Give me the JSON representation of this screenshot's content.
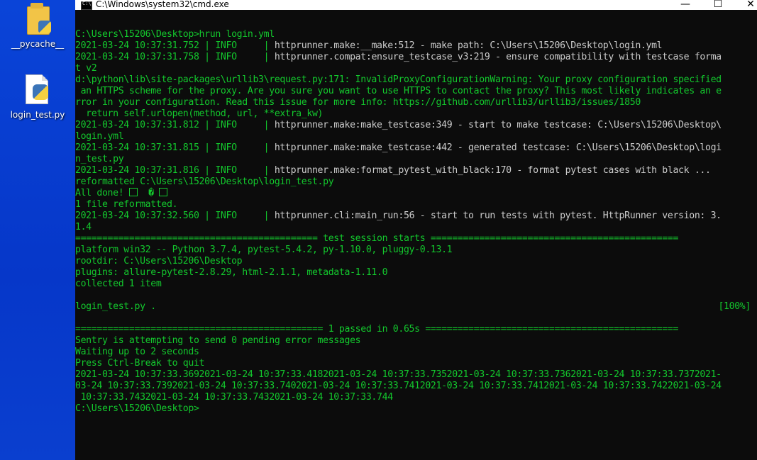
{
  "desktop": {
    "icons": [
      {
        "label": "__pycache__",
        "kind": "folder"
      },
      {
        "label": "login_test.py",
        "kind": "python-file"
      }
    ]
  },
  "window": {
    "title": "C:\\Windows\\system32\\cmd.exe",
    "controls": {
      "minimize": "—",
      "maximize": "☐",
      "close": "✕"
    }
  },
  "console": {
    "lines": [
      "C:\\Users\\15206\\Desktop>hrun login.yml",
      "2021-03-24 10:37:31.752 | INFO     | httprunner.make:__make:512 - make path: C:\\Users\\15206\\Desktop\\login.yml",
      "2021-03-24 10:37:31.758 | INFO     | httprunner.compat:ensure_testcase_v3:219 - ensure compatibility with testcase forma",
      "t v2",
      "d:\\python\\lib\\site-packages\\urllib3\\request.py:171: InvalidProxyConfigurationWarning: Your proxy configuration specified",
      " an HTTPS scheme for the proxy. Are you sure you want to use HTTPS to contact the proxy? This most likely indicates an e",
      "rror in your configuration. Read this issue for more info: https://github.com/urllib3/urllib3/issues/1850",
      "  return self.urlopen(method, url, **extra_kw)",
      "2021-03-24 10:37:31.812 | INFO     | httprunner.make:make_testcase:349 - start to make testcase: C:\\Users\\15206\\Desktop\\",
      "login.yml",
      "2021-03-24 10:37:31.815 | INFO     | httprunner.make:make_testcase:442 - generated testcase: C:\\Users\\15206\\Desktop\\logi",
      "n_test.py",
      "2021-03-24 10:37:31.816 | INFO     | httprunner.make:format_pytest_with_black:170 - format pytest cases with black ...",
      "reformatted C:\\Users\\15206\\Desktop\\login_test.py",
      "All done! ",
      "1 file reformatted.",
      "2021-03-24 10:37:32.560 | INFO     | httprunner.cli:main_run:56 - start to run tests with pytest. HttpRunner version: 3.",
      "1.4",
      "============================================= test session starts ==============================================",
      "platform win32 -- Python 3.7.4, pytest-5.4.2, py-1.10.0, pluggy-0.13.1",
      "rootdir: C:\\Users\\15206\\Desktop",
      "plugins: allure-pytest-2.8.29, html-2.1.1, metadata-1.11.0",
      "collected 1 item",
      "",
      "login_test.py .",
      "",
      "============================================== 1 passed in 0.65s ===============================================",
      "Sentry is attempting to send 0 pending error messages",
      "Waiting up to 2 seconds",
      "Press Ctrl-Break to quit",
      "2021-03-24 10:37:33.3692021-03-24 10:37:33.4182021-03-24 10:37:33.7352021-03-24 10:37:33.7362021-03-24 10:37:33.7372021-",
      "03-24 10:37:33.7392021-03-24 10:37:33.7402021-03-24 10:37:33.7412021-03-24 10:37:33.7412021-03-24 10:37:33.7422021-03-24",
      " 10:37:33.7432021-03-24 10:37:33.7432021-03-24 10:37:33.744",
      "C:\\Users\\15206\\Desktop>"
    ],
    "progress_label": "[100%]",
    "all_done_glyph": "�"
  },
  "colors": {
    "desktop_bg": "#0b3fd4",
    "console_bg": "#0c0c0c",
    "console_text": "#13c82d",
    "log_separator_text": "#cccccc"
  }
}
